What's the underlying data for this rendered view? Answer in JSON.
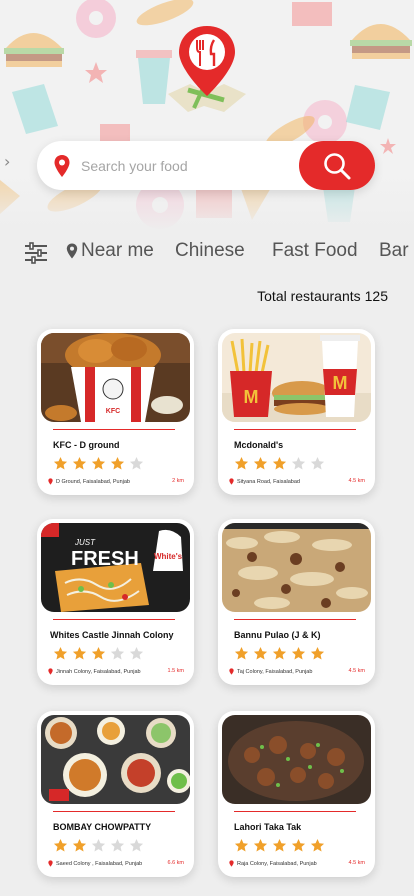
{
  "search": {
    "placeholder": "Search your food"
  },
  "categories": {
    "near_me": "Near me",
    "items": [
      "Chinese",
      "Fast Food",
      "Bar"
    ]
  },
  "summary": {
    "label": "Total restaurants",
    "count": "125"
  },
  "colors": {
    "accent": "#e42a2a",
    "star_on": "#f0a02a",
    "star_off": "#d9d9d9"
  },
  "restaurants": [
    {
      "name": "KFC - D ground",
      "rating": 4,
      "address": "D Ground, Faisalabad, Punjab",
      "distance": "2 km"
    },
    {
      "name": "Mcdonald's",
      "rating": 3,
      "address": "Sityana Road, Faisalabad",
      "distance": "4.5 km"
    },
    {
      "name": "Whites Castle Jinnah Colony",
      "rating": 3,
      "address": "Jinnah Colony, Faisalabad, Punjab",
      "distance": "1.5 km"
    },
    {
      "name": "Bannu Pulao (J & K)",
      "rating": 5,
      "address": "Taj Colony, Faisalabad, Punjab",
      "distance": "4.5 km"
    },
    {
      "name": "BOMBAY CHOWPATTY",
      "rating": 2,
      "address": "Saeed Colony , Faisalabad, Punjab",
      "distance": "6.6 km"
    },
    {
      "name": "Lahori Taka Tak",
      "rating": 5,
      "address": "Raja Colony, Faisalabad, Punjab",
      "distance": "4.5 km"
    }
  ],
  "photo_text": {
    "kfc": "KFC",
    "fresh": "FRESH",
    "just": "JUST",
    "whites": "White's"
  }
}
